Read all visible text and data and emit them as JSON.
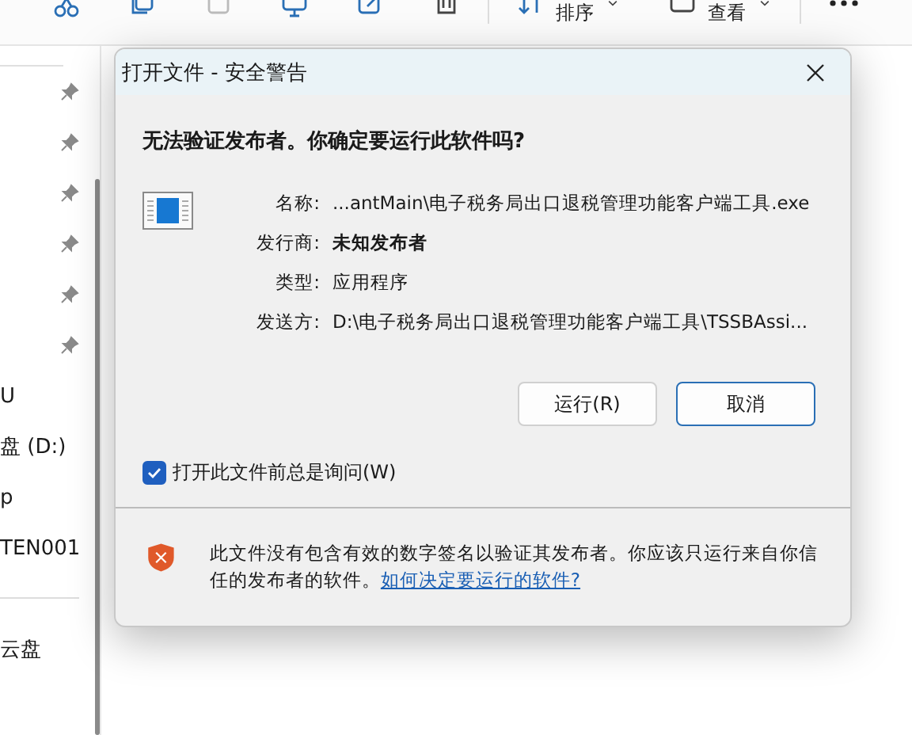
{
  "toolbar": {
    "sort_label": "排序",
    "view_label": "查看"
  },
  "sidebar": {
    "pins": [
      {
        "pinned": true
      },
      {
        "pinned": true
      },
      {
        "pinned": true
      },
      {
        "pinned": true
      },
      {
        "pinned": true
      },
      {
        "pinned": true
      }
    ],
    "items": [
      {
        "label": "U"
      },
      {
        "label": "盘 (D:)"
      },
      {
        "label": "p"
      },
      {
        "label": "TEN001"
      },
      {
        "label": "云盘"
      }
    ]
  },
  "dialog": {
    "title": "打开文件 - 安全警告",
    "heading": "无法验证发布者。你确定要运行此软件吗?",
    "fields": [
      {
        "label": "名称:",
        "value": "...antMain\\电子税务局出口退税管理功能客户端工具.exe",
        "emphasis": false
      },
      {
        "label": "发行商:",
        "value": "未知发布者",
        "emphasis": true
      },
      {
        "label": "类型:",
        "value": "应用程序",
        "emphasis": false
      },
      {
        "label": "发送方:",
        "value": "D:\\电子税务局出口退税管理功能客户端工具\\TSSBAssi...",
        "emphasis": false
      }
    ],
    "buttons": [
      {
        "label": "运行(R)",
        "default": false
      },
      {
        "label": "取消",
        "default": true
      }
    ],
    "checkbox": {
      "label": "打开此文件前总是询问(W)",
      "checked": true
    },
    "warning": {
      "text": "此文件没有包含有效的数字签名以验证其发布者。你应该只运行来自你信任的发布者的软件。",
      "link": "如何决定要运行的软件?"
    }
  }
}
